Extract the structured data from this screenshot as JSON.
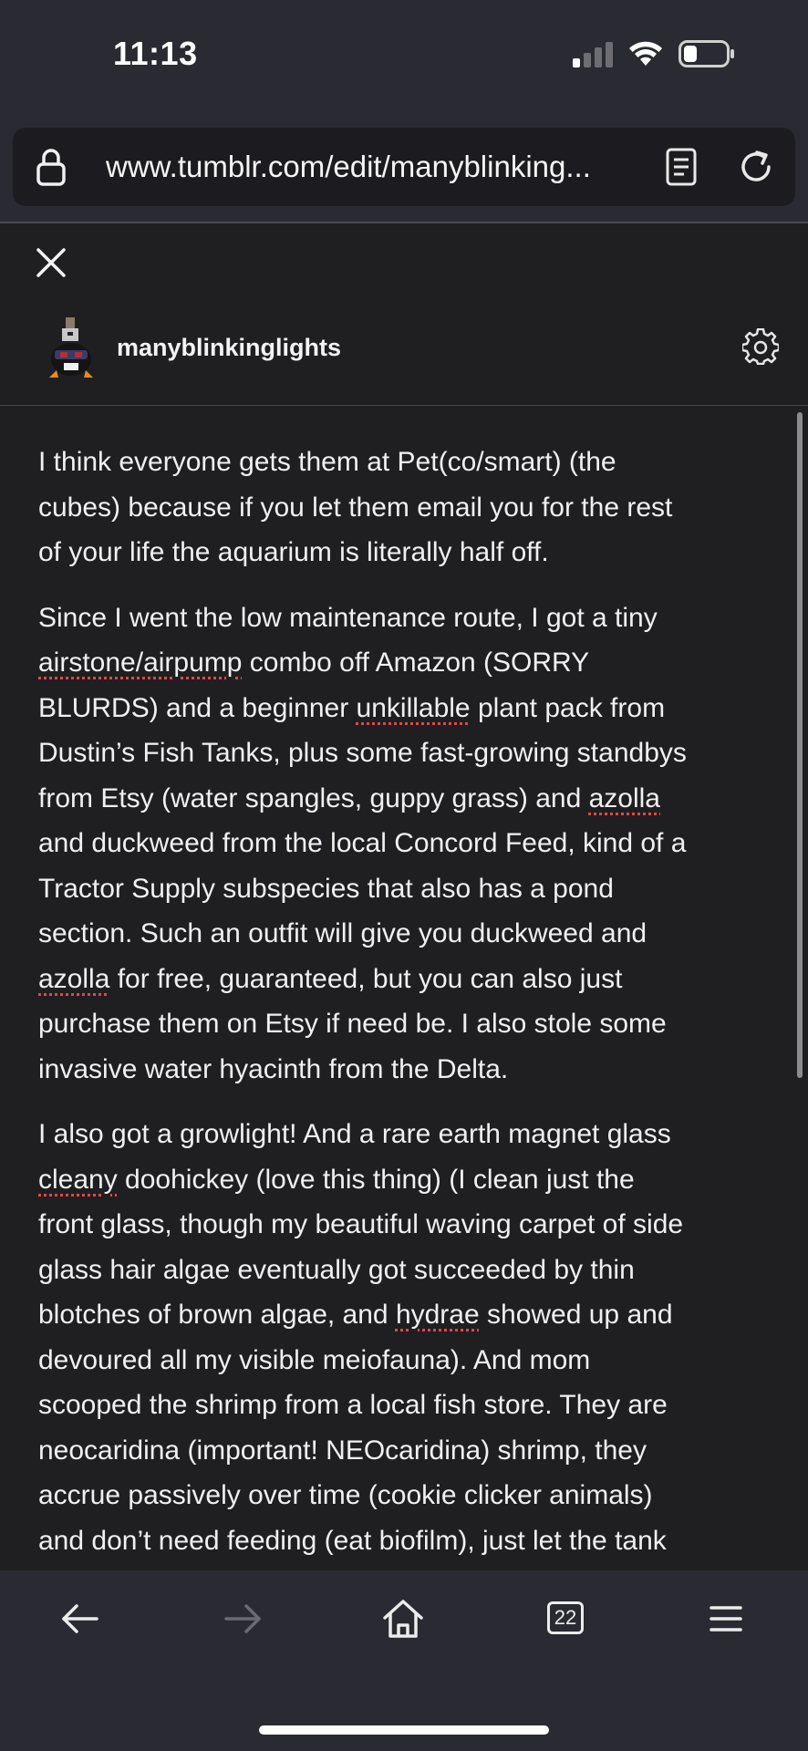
{
  "status_bar": {
    "time": "11:13",
    "signal_bars_active": 1,
    "signal_bars_total": 4,
    "wifi_icon": "wifi-icon",
    "battery_icon": "battery-icon"
  },
  "browser": {
    "url": "www.tumblr.com/edit/manyblinking...",
    "lock_icon": "lock-icon",
    "reader_icon": "reader-mode-icon",
    "reload_icon": "reload-icon"
  },
  "editor": {
    "close_icon": "close-icon",
    "username": "manyblinkinglights",
    "settings_icon": "gear-icon"
  },
  "post": {
    "paragraphs": [
      "I think everyone gets them at Pet(co/smart) (the\ncubes) because if you let them email you for the rest\nof your life the aquarium is literally half off.",
      "Since I went the low maintenance route, I got a tiny\nairstone/airpump combo off Amazon (SORRY\nBLURDS) and a beginner unkillable plant pack from\nDustin’s Fish Tanks, plus some fast-growing standbys\nfrom Etsy (water spangles, guppy grass) and azolla\nand duckweed from the local Concord Feed, kind of a\nTractor Supply subspecies that also has a pond\nsection. Such an outfit will give you duckweed and\nazolla for free, guaranteed, but you can also just\npurchase them on Etsy if need be. I also stole some\ninvasive water hyacinth from the Delta.",
      "I also got a growlight! And a rare earth magnet glass\ncleany doohickey (love this thing) (I clean just the\nfront glass, though my beautiful waving carpet of side\nglass hair algae eventually got succeeded by thin\nblotches of brown algae, and hydrae showed up and\ndevoured all my visible meiofauna). And mom\nscooped the shrimp from a local fish store. They are\nneocaridina (important! NEOcaridina) shrimp, they\naccrue passively over time (cookie clicker animals)\nand don’t need feeding (eat biofilm), just let the tank\nmature for at least six weeks with some pond snails in"
    ]
  },
  "bottom_nav": {
    "back_icon": "back-arrow-icon",
    "forward_icon": "forward-arrow-icon",
    "home_icon": "home-icon",
    "tabs_count": "22",
    "menu_icon": "menu-icon"
  },
  "colors": {
    "background": "#1f1f21",
    "bars": "#2a2a32",
    "text": "#f0f0f0",
    "spellcheck": "#e04848"
  }
}
